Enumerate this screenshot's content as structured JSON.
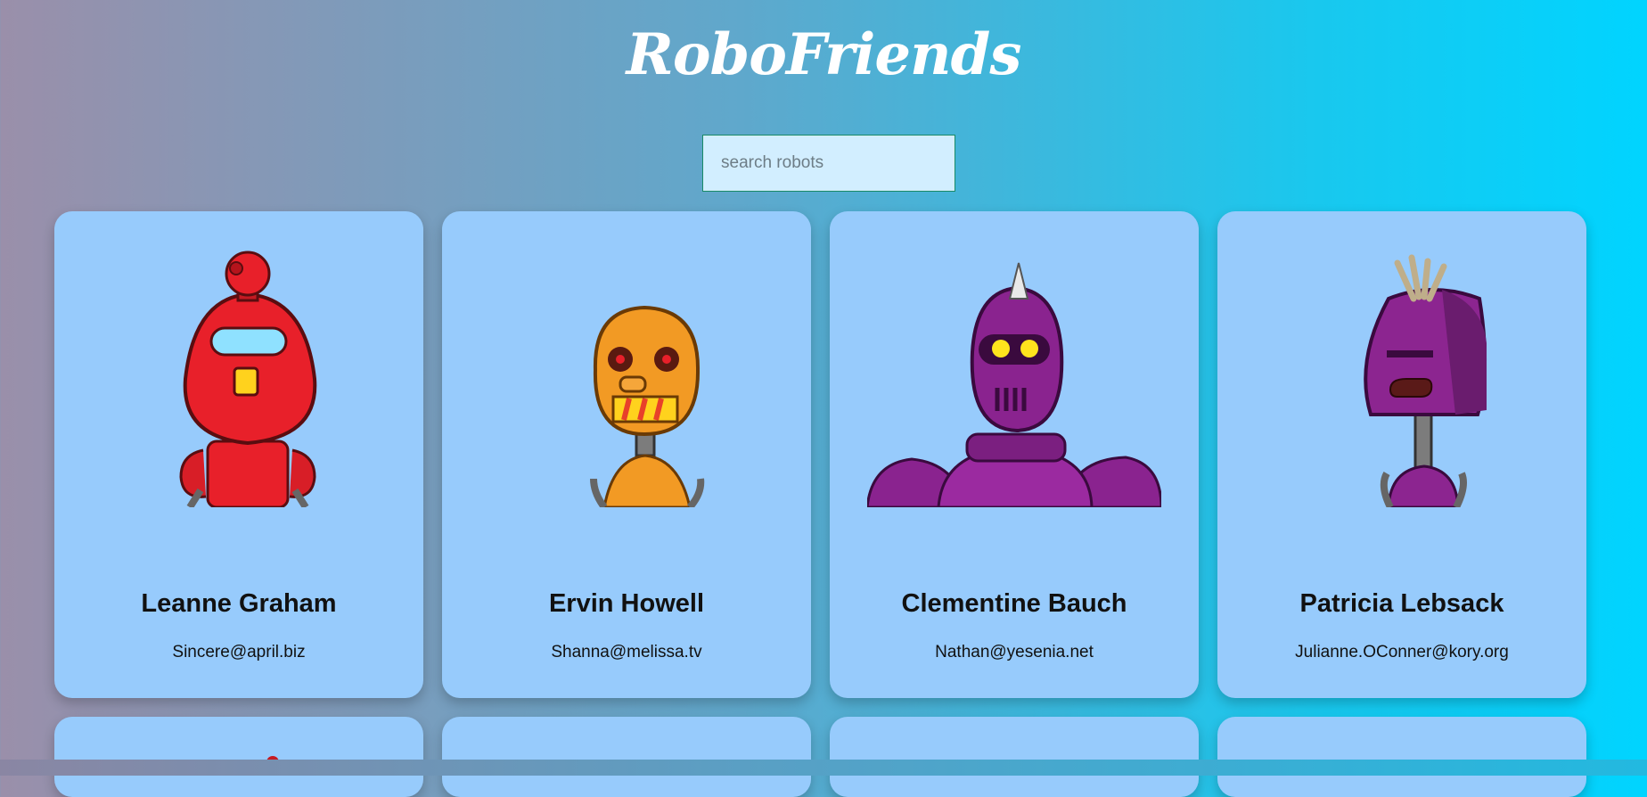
{
  "app": {
    "title": "RoboFriends"
  },
  "search": {
    "placeholder": "search robots",
    "value": ""
  },
  "robots": [
    {
      "name": "Leanne Graham",
      "email": "Sincere@april.biz",
      "color": "#e8202a"
    },
    {
      "name": "Ervin Howell",
      "email": "Shanna@melissa.tv",
      "color": "#f29a24"
    },
    {
      "name": "Clementine Bauch",
      "email": "Nathan@yesenia.net",
      "color": "#8a238f"
    },
    {
      "name": "Patricia Lebsack",
      "email": "Julianne.OConner@kory.org",
      "color": "#8c2590"
    }
  ],
  "colors": {
    "card": "#97cbfc",
    "title": "#ffffff"
  }
}
